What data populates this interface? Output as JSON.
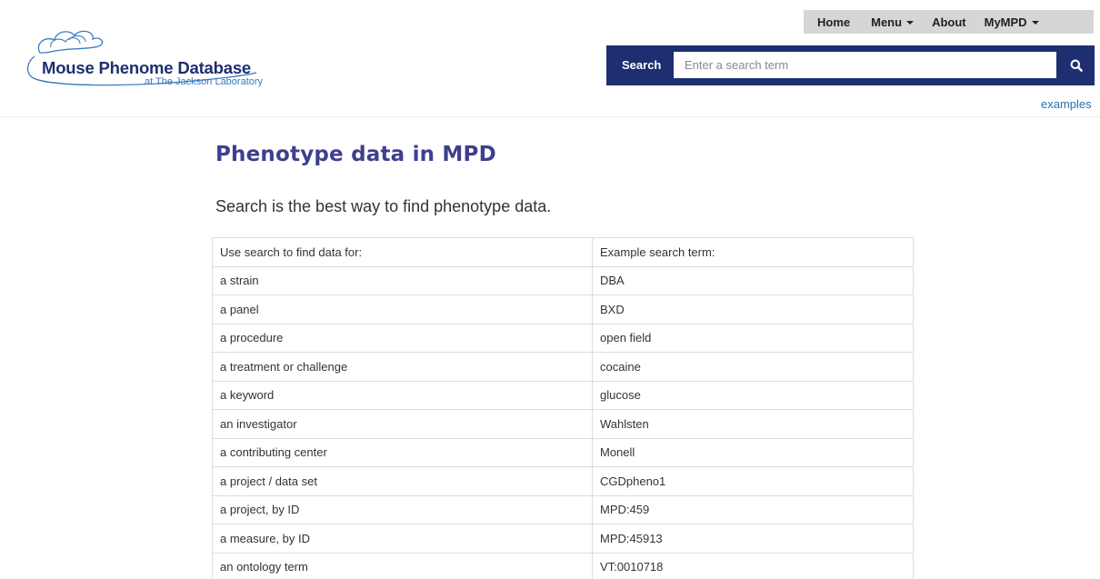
{
  "brand": {
    "title": "Mouse Phenome Database",
    "subtitle": "at The Jackson Laboratory",
    "color": "#1d2f70"
  },
  "nav": {
    "items": [
      {
        "label": "Home",
        "dropdown": false
      },
      {
        "label": "Menu",
        "dropdown": true
      },
      {
        "label": "About",
        "dropdown": false
      },
      {
        "label": "MyMPD",
        "dropdown": true
      }
    ]
  },
  "search": {
    "label": "Search",
    "placeholder": "Enter a search term",
    "value": "",
    "button_icon": "search-icon",
    "examples_link": "examples",
    "bar_color": "#1d2f70"
  },
  "main": {
    "title": "Phenotype data in MPD",
    "intro": "Search is the best way to find phenotype data.",
    "table": {
      "header": [
        "Use search to find data for:",
        "Example search term:"
      ],
      "rows": [
        [
          "a strain",
          "DBA"
        ],
        [
          "a panel",
          "BXD"
        ],
        [
          "a procedure",
          "open field"
        ],
        [
          "a treatment or challenge",
          "cocaine"
        ],
        [
          "a keyword",
          "glucose"
        ],
        [
          "an investigator",
          "Wahlsten"
        ],
        [
          "a contributing center",
          "Monell"
        ],
        [
          "a project / data set",
          "CGDpheno1"
        ],
        [
          "a project, by ID",
          "MPD:459"
        ],
        [
          "a measure, by ID",
          "MPD:45913"
        ],
        [
          "an ontology term",
          "VT:0010718"
        ]
      ]
    }
  }
}
